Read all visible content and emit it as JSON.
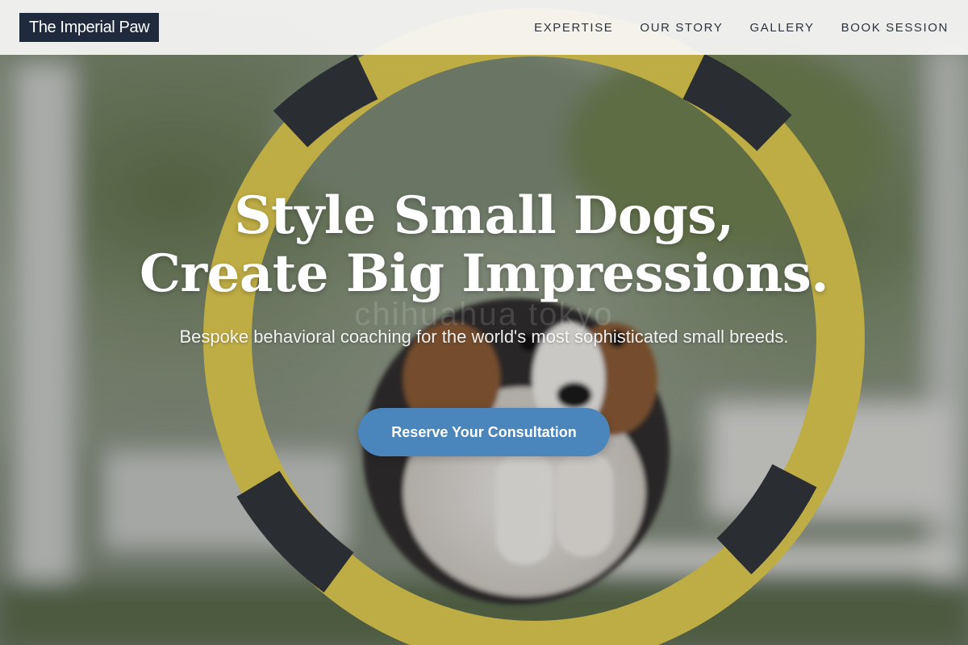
{
  "header": {
    "logo_text": "The Imperial Paw",
    "nav": [
      {
        "label": "EXPERTISE"
      },
      {
        "label": "OUR STORY"
      },
      {
        "label": "GALLERY"
      },
      {
        "label": "BOOK SESSION"
      }
    ]
  },
  "hero": {
    "title_line1": "Style Small Dogs,",
    "title_line2": "Create Big Impressions.",
    "subtitle": "Bespoke behavioral coaching for the world's most sophisticated small breeds.",
    "cta_label": "Reserve Your Consultation",
    "watermark": "chihuahua tokyo",
    "background_image": "dog-jumping-through-agility-hoop"
  },
  "colors": {
    "logo_bg": "#1f2a3d",
    "header_bg": "#f8f8f6",
    "nav_text": "#2b3340",
    "cta_bg": "#4a86bb",
    "hoop_yellow": "#e6cf52",
    "hoop_tape": "#2f3236"
  }
}
